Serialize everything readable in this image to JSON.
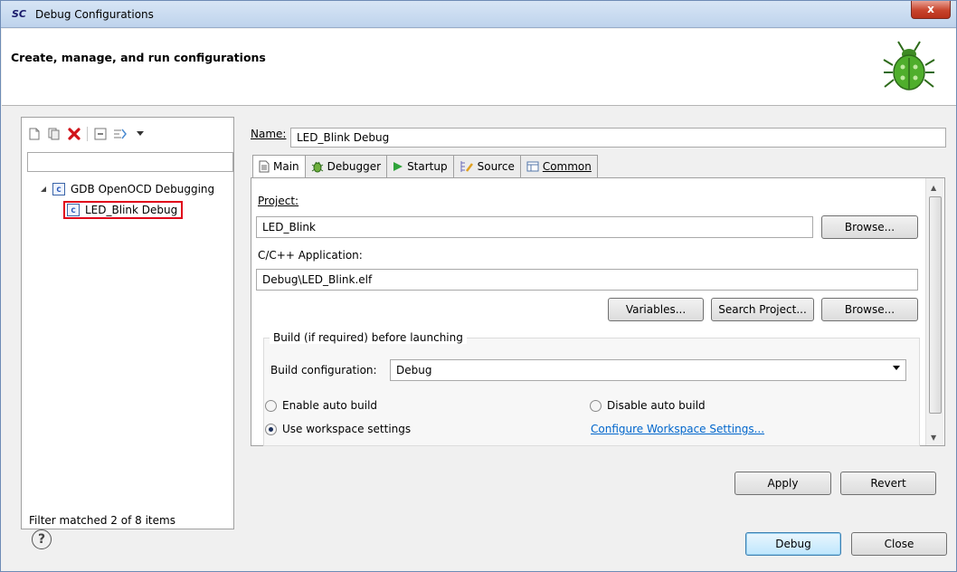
{
  "window": {
    "logo": "SC",
    "title": "Debug Configurations",
    "close_label": "x"
  },
  "banner": {
    "title": "Create, manage, and run configurations",
    "icon": "bug-icon"
  },
  "left_pane": {
    "toolbar": [
      "new-config-icon",
      "duplicate-icon",
      "delete-icon",
      "collapse-all-icon",
      "filter-icon",
      "dropdown-icon"
    ],
    "filter_placeholder": "",
    "tree": {
      "parent": "GDB OpenOCD Debugging",
      "child": "LED_Blink Debug",
      "highlight_color": "#e0001a"
    },
    "status": "Filter matched 2 of 8 items"
  },
  "config": {
    "name_label": "Name:",
    "name_value": "LED_Blink Debug",
    "tabs": [
      {
        "label": "Main",
        "icon": "main-tab-icon",
        "selected": true
      },
      {
        "label": "Debugger",
        "icon": "debugger-tab-icon",
        "selected": false
      },
      {
        "label": "Startup",
        "icon": "startup-tab-icon",
        "selected": false
      },
      {
        "label": "Source",
        "icon": "source-tab-icon",
        "selected": false
      },
      {
        "label": "Common",
        "icon": "common-tab-icon",
        "selected": false
      }
    ],
    "project_label": "Project:",
    "project_value": "LED_Blink",
    "browse_label": "Browse...",
    "application_label": "C/C++ Application:",
    "application_value": "Debug\\LED_Blink.elf",
    "variables_label": "Variables...",
    "search_project_label": "Search Project...",
    "browse2_label": "Browse...",
    "build_group": {
      "title": "Build (if required) before launching",
      "config_label": "Build configuration:",
      "config_value": "Debug",
      "enable_auto": "Enable auto build",
      "disable_auto": "Disable auto build",
      "use_workspace": "Use workspace settings",
      "selected_option": "Use workspace settings",
      "configure_link": "Configure Workspace Settings..."
    },
    "apply_label": "Apply",
    "revert_label": "Revert"
  },
  "footer": {
    "help_label": "?",
    "debug_label": "Debug",
    "close_label": "Close"
  },
  "colors": {
    "accent": "#3c7fb1",
    "link": "#0066cc",
    "titlebar": "#bed3ec"
  }
}
